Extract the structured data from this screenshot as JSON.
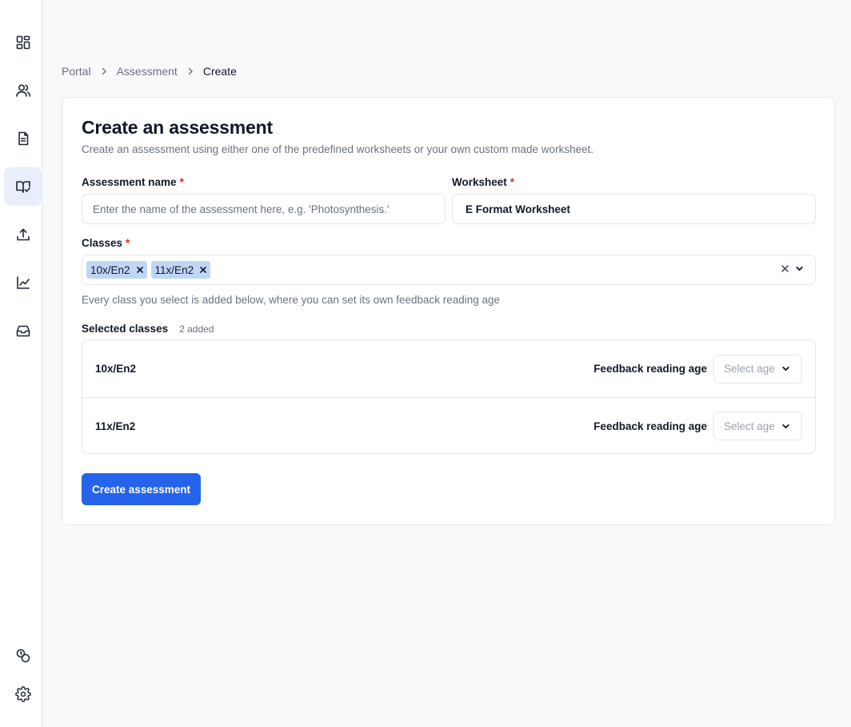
{
  "sidebar": {
    "items": [
      {
        "name": "dashboard-icon"
      },
      {
        "name": "users-icon"
      },
      {
        "name": "document-icon"
      },
      {
        "name": "book-check-icon",
        "active": true
      },
      {
        "name": "upload-icon"
      },
      {
        "name": "chart-icon"
      },
      {
        "name": "inbox-icon"
      }
    ],
    "bottom_items": [
      {
        "name": "coins-icon"
      },
      {
        "name": "gear-icon"
      }
    ]
  },
  "breadcrumb": [
    "Portal",
    "Assessment",
    "Create"
  ],
  "form": {
    "title": "Create an assessment",
    "subtitle": "Create an assessment using either one of the predefined worksheets or your own custom made worksheet.",
    "assessment_name": {
      "label": "Assessment name",
      "required_mark": "*",
      "value": "",
      "placeholder": "Enter the name of the assessment here, e.g. 'Photosynthesis.'"
    },
    "worksheet": {
      "label": "Worksheet",
      "required_mark": "*",
      "value": "E Format Worksheet"
    },
    "classes": {
      "label": "Classes",
      "required_mark": "*",
      "selected": [
        "10x/En2",
        "11x/En2"
      ],
      "helper": "Every class you select is added below, where you can set its own feedback reading age"
    },
    "selected_classes": {
      "label": "Selected classes",
      "count": "2 added",
      "rows": [
        {
          "class": "10x/En2",
          "age_label": "Feedback reading age",
          "age_placeholder": "Select age"
        },
        {
          "class": "11x/En2",
          "age_label": "Feedback reading age",
          "age_placeholder": "Select age"
        }
      ]
    },
    "submit_label": "Create assessment"
  },
  "colors": {
    "primary": "#2563eb",
    "chip": "#bfd7f6",
    "required": "#dc2626",
    "active_nav": "#e8effb"
  }
}
